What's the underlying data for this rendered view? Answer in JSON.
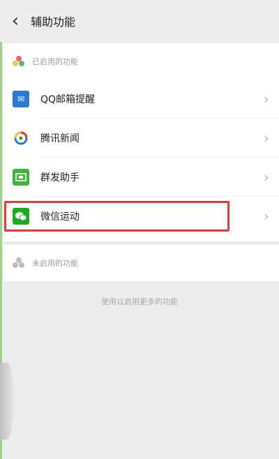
{
  "header": {
    "title": "辅助功能",
    "back_icon": "chevron-left-icon"
  },
  "enabled_section": {
    "label": "已启用的功能",
    "items": [
      {
        "label": "QQ邮箱提醒",
        "icon": "mail-icon",
        "icon_color": "#2b7bd6"
      },
      {
        "label": "腾讯新闻",
        "icon": "news-icon",
        "icon_color": "#ffffff"
      },
      {
        "label": "群发助手",
        "icon": "broadcast-icon",
        "icon_color": "#3fb43f"
      },
      {
        "label": "微信运动",
        "icon": "wechat-sport-icon",
        "icon_color": "#1aad19"
      }
    ]
  },
  "disabled_section": {
    "label": "未启用的功能"
  },
  "hint": "使用以启用更多的功能",
  "colors": {
    "highlight": "#e53935",
    "accent_green": "#1aad19",
    "background": "#ededed"
  }
}
